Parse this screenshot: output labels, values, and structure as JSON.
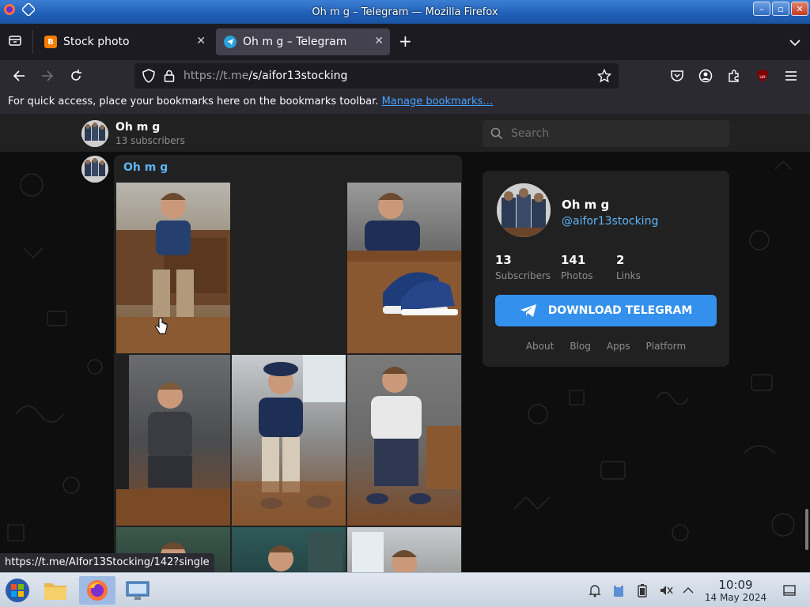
{
  "window": {
    "title": "Oh m g – Telegram — Mozilla Firefox"
  },
  "tabs": [
    {
      "label": "Stock photo",
      "active": false,
      "favicon": "blogger-icon",
      "color": "#f57d00"
    },
    {
      "label": "Oh m g – Telegram",
      "active": true,
      "favicon": "telegram-icon",
      "color": "#2aa1db"
    }
  ],
  "navbar": {
    "url_host": "https://t.me",
    "url_path": "/s/aifor13stocking"
  },
  "bookmarks_bar": {
    "message": "For quick access, place your bookmarks here on the bookmarks toolbar.",
    "link": "Manage bookmarks…"
  },
  "telegram": {
    "channel_name": "Oh m g",
    "subscribers_text": "13 subscribers",
    "search_placeholder": "Search",
    "message_author": "Oh m g",
    "card": {
      "name": "Oh m g",
      "handle": "@aifor13stocking",
      "stats": [
        {
          "num": "13",
          "label": "Subscribers"
        },
        {
          "num": "141",
          "label": "Photos"
        },
        {
          "num": "2",
          "label": "Links"
        }
      ],
      "download_label": "DOWNLOAD TELEGRAM",
      "links": [
        "About",
        "Blog",
        "Apps",
        "Platform"
      ]
    }
  },
  "status_link": "https://t.me/AIfor13Stocking/142?single",
  "taskbar": {
    "time": "10:09",
    "date": "14 May 2024"
  },
  "colors": {
    "accent": "#3390ec",
    "link": "#5eb5f7"
  }
}
